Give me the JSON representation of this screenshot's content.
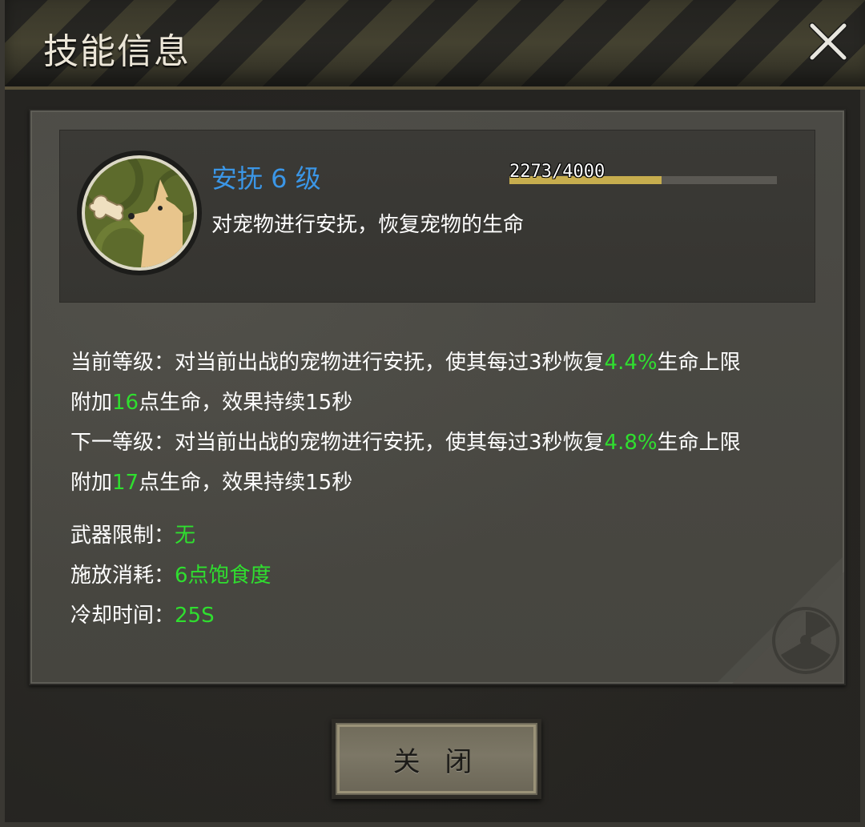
{
  "header": {
    "title": "技能信息",
    "close_icon": "close-icon"
  },
  "skill": {
    "icon": "dog-pet-icon",
    "name": "安抚 6 级",
    "description": "对宠物进行安抚，恢复宠物的生命",
    "xp_text": "2273/4000",
    "xp_fraction": 0.568,
    "name_color": "#3b96e6",
    "progress_color": "#c7ad4e"
  },
  "levels": {
    "current": {
      "prefix": "当前等级：对当前出战的宠物进行安抚，使其每过3秒恢复",
      "percent": "4.4%",
      "mid": "生命上限",
      "line2_prefix": "附加",
      "points": "16",
      "suffix": "点生命，效果持续15秒"
    },
    "next": {
      "prefix": "下一等级：对当前出战的宠物进行安抚，使其每过3秒恢复",
      "percent": "4.8%",
      "mid": "生命上限",
      "line2_prefix": "附加",
      "points": "17",
      "suffix": "点生命，效果持续15秒"
    }
  },
  "properties": [
    {
      "label": "武器限制：",
      "value": "无"
    },
    {
      "label": "施放消耗：",
      "value": "6点饱食度"
    },
    {
      "label": "冷却时间：",
      "value": "25S"
    }
  ],
  "footer": {
    "close_label": "关 闭"
  },
  "colors": {
    "highlight_green": "#2fdf2f"
  },
  "decor": {
    "corner_icon": "radiation-icon"
  }
}
